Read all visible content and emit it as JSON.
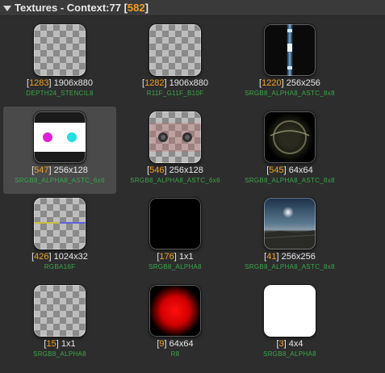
{
  "header": {
    "title_prefix": "Textures - Context:77 [",
    "count": "582",
    "title_suffix": "]"
  },
  "textures": [
    {
      "index": "1283",
      "size": "1906x880",
      "format": "DEPTH24_STENCIL8",
      "preview": "transparent"
    },
    {
      "index": "1282",
      "size": "1906x880",
      "format": "R11F_G11F_B10F",
      "preview": "transparent"
    },
    {
      "index": "1220",
      "size": "256x256",
      "format": "SRGB8_ALPHA8_ASTC_8x8",
      "preview": "light-strip"
    },
    {
      "index": "547",
      "size": "256x128",
      "format": "SRGB8_ALPHA8_ASTC_6x6",
      "preview": "dots"
    },
    {
      "index": "546",
      "size": "256x128",
      "format": "SRGB8_ALPHA8_ASTC_6x6",
      "preview": "dots-faint"
    },
    {
      "index": "545",
      "size": "64x64",
      "format": "SRGB8_ALPHA8_ASTC_8x8",
      "preview": "fisheye"
    },
    {
      "index": "426",
      "size": "1024x32",
      "format": "RGBA16F",
      "preview": "gradient-strip"
    },
    {
      "index": "176",
      "size": "1x1",
      "format": "SRGB8_ALPHA8",
      "preview": "black"
    },
    {
      "index": "41",
      "size": "256x256",
      "format": "SRGB8_ALPHA8_ASTC_8x8",
      "preview": "night-sky"
    },
    {
      "index": "15",
      "size": "1x1",
      "format": "SRGB8_ALPHA8",
      "preview": "transparent"
    },
    {
      "index": "9",
      "size": "64x64",
      "format": "R8",
      "preview": "red-radial"
    },
    {
      "index": "3",
      "size": "4x4",
      "format": "SRGB8_ALPHA8",
      "preview": "white"
    }
  ],
  "selected_index": 3,
  "colors": {
    "index_accent": "#f0a020",
    "format_green": "#3aa84a",
    "background": "#2d2d2d"
  }
}
